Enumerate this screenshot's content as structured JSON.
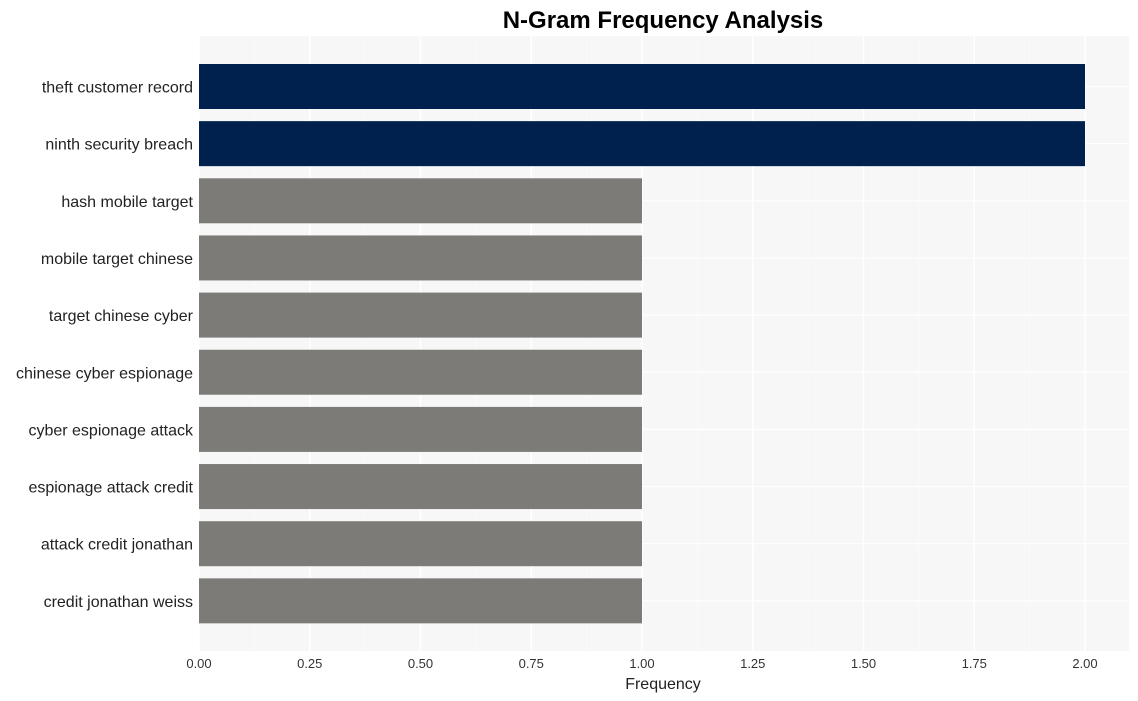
{
  "chart_data": {
    "type": "bar",
    "orientation": "horizontal",
    "title": "N-Gram Frequency Analysis",
    "xlabel": "Frequency",
    "ylabel": "",
    "xlim": [
      0,
      2.1
    ],
    "x_ticks": [
      "0.00",
      "0.25",
      "0.50",
      "0.75",
      "1.00",
      "1.25",
      "1.50",
      "1.75",
      "2.00"
    ],
    "x_tick_values": [
      0,
      0.25,
      0.5,
      0.75,
      1.0,
      1.25,
      1.5,
      1.75,
      2.0
    ],
    "grid": true,
    "categories": [
      "theft customer record",
      "ninth security breach",
      "hash mobile target",
      "mobile target chinese",
      "target chinese cyber",
      "chinese cyber espionage",
      "cyber espionage attack",
      "espionage attack credit",
      "attack credit jonathan",
      "credit jonathan weiss"
    ],
    "values": [
      2,
      2,
      1,
      1,
      1,
      1,
      1,
      1,
      1,
      1
    ],
    "colors": {
      "highlight": "#00214e",
      "default": "#7c7b77",
      "plot_background": "#f7f7f7",
      "grid": "#ffffff"
    }
  }
}
